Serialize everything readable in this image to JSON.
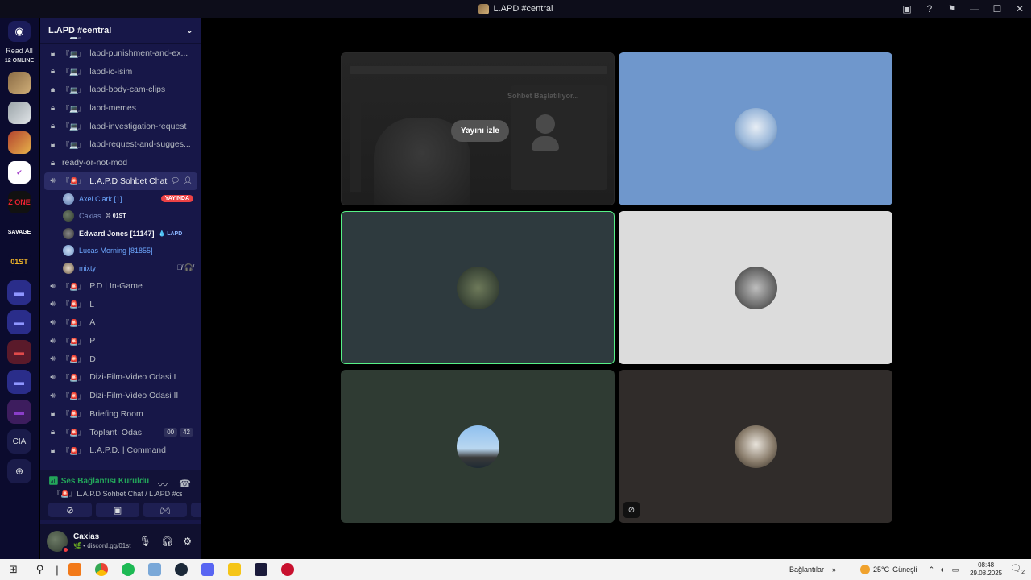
{
  "window": {
    "title": "L.APD #central"
  },
  "guild_bar": {
    "read_all": "Read All",
    "online": "12 ONLINE",
    "cia_label": "CİA",
    "zone_label": "Z ONE",
    "savage_label": "SAVAGE",
    "o1st_label": "01ST"
  },
  "server": {
    "name": "L.APD #central"
  },
  "channels": [
    {
      "name": "lapd-rules",
      "type": "text-locked",
      "emoji": "『💻』"
    },
    {
      "name": "lapd-punishment-and-ex...",
      "type": "text-locked",
      "emoji": "『💻』"
    },
    {
      "name": "lapd-ic-isim",
      "type": "text-locked",
      "emoji": "『💻』"
    },
    {
      "name": "lapd-body-cam-clips",
      "type": "text-locked",
      "emoji": "『💻』"
    },
    {
      "name": "lapd-memes",
      "type": "text-locked",
      "emoji": "『💻』"
    },
    {
      "name": "lapd-investigation-request",
      "type": "text-locked",
      "emoji": "『💻』"
    },
    {
      "name": "lapd-request-and-sugges...",
      "type": "text-locked",
      "emoji": "『💻』"
    },
    {
      "name": "ready-or-not-mod",
      "type": "text-locked",
      "emoji": ""
    }
  ],
  "active_voice": {
    "name": "L.A.P.D Sohbet Chat",
    "emoji": "『🚨』"
  },
  "voice_users": [
    {
      "name": "Axel Clark [1]",
      "badge": "YAYINDA",
      "style": "blue"
    },
    {
      "name": "Caxias",
      "tag": "😠 01ST",
      "style": "dim"
    },
    {
      "name": "Edward Jones [11147]",
      "tag": "💧 LAPD",
      "style": "white"
    },
    {
      "name": "Lucas Morning [81855]",
      "style": "blue"
    },
    {
      "name": "mixty",
      "trail": "🎙̸ 🎧̸",
      "style": "blue"
    }
  ],
  "voice_channels": [
    {
      "name": "P.D | In-Game",
      "emoji": "『🚨』"
    },
    {
      "name": "L",
      "emoji": "『🚨』"
    },
    {
      "name": "A",
      "emoji": "『🚨』"
    },
    {
      "name": "P",
      "emoji": "『🚨』"
    },
    {
      "name": "D",
      "emoji": "『🚨』"
    },
    {
      "name": "Dizi-Film-Video Odasi I",
      "emoji": "『🚨』"
    },
    {
      "name": "Dizi-Film-Video Odasi II",
      "emoji": "『🚨』"
    },
    {
      "name": "Briefing Room",
      "emoji": "『🚨』",
      "locked": true
    },
    {
      "name": "Toplantı Odası",
      "emoji": "『🚨』",
      "locked": true,
      "counts": [
        "00",
        "42"
      ]
    },
    {
      "name": "L.A.P.D. | Command",
      "emoji": "『🚨』",
      "locked": true
    }
  ],
  "voice_panel": {
    "status": "Ses Bağlantısı Kuruldu",
    "location": "『🚨』L.A.P.D Sohbet Chat / L.APD #cent..."
  },
  "user_panel": {
    "name": "Caxias",
    "status": "🌿 • discord.gg/01st"
  },
  "stage": {
    "watch_button": "Yayını izle",
    "stream_overlay_text": "Sohbet Başlatılıyor..."
  },
  "taskbar": {
    "connections": "Bağlantılar",
    "weather_temp": "25°C",
    "weather_desc": "Güneşli",
    "time": "08:48",
    "date": "29.08.2025",
    "notif_count": "2"
  },
  "colors": {
    "accent": "#5865f2",
    "live_red": "#ed4245",
    "connected_green": "#23a55a",
    "speaking_border": "#57f287"
  }
}
